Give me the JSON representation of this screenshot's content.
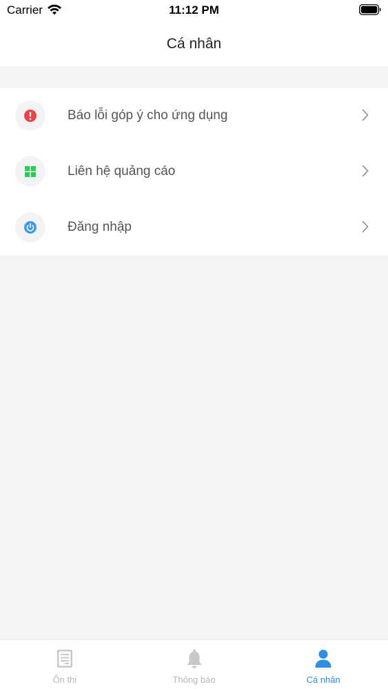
{
  "status_bar": {
    "carrier": "Carrier",
    "time": "11:12 PM"
  },
  "nav": {
    "title": "Cá nhân"
  },
  "menu": {
    "items": [
      {
        "label": "Báo lỗi góp ý cho ứng dụng",
        "icon": "alert-icon",
        "color": "#e8444a"
      },
      {
        "label": "Liên hệ quảng cáo",
        "icon": "grid-icon",
        "color": "#2ecc5a"
      },
      {
        "label": "Đăng nhập",
        "icon": "power-icon",
        "color": "#3c9ae8"
      }
    ]
  },
  "tabs": [
    {
      "label": "Ôn thi",
      "icon": "document-icon",
      "active": false
    },
    {
      "label": "Thông báo",
      "icon": "bell-icon",
      "active": false
    },
    {
      "label": "Cá nhân",
      "icon": "person-icon",
      "active": true
    }
  ],
  "colors": {
    "accent": "#2f8ee0",
    "inactive_tab": "#b8b8b8",
    "background": "#f4f4f7"
  }
}
